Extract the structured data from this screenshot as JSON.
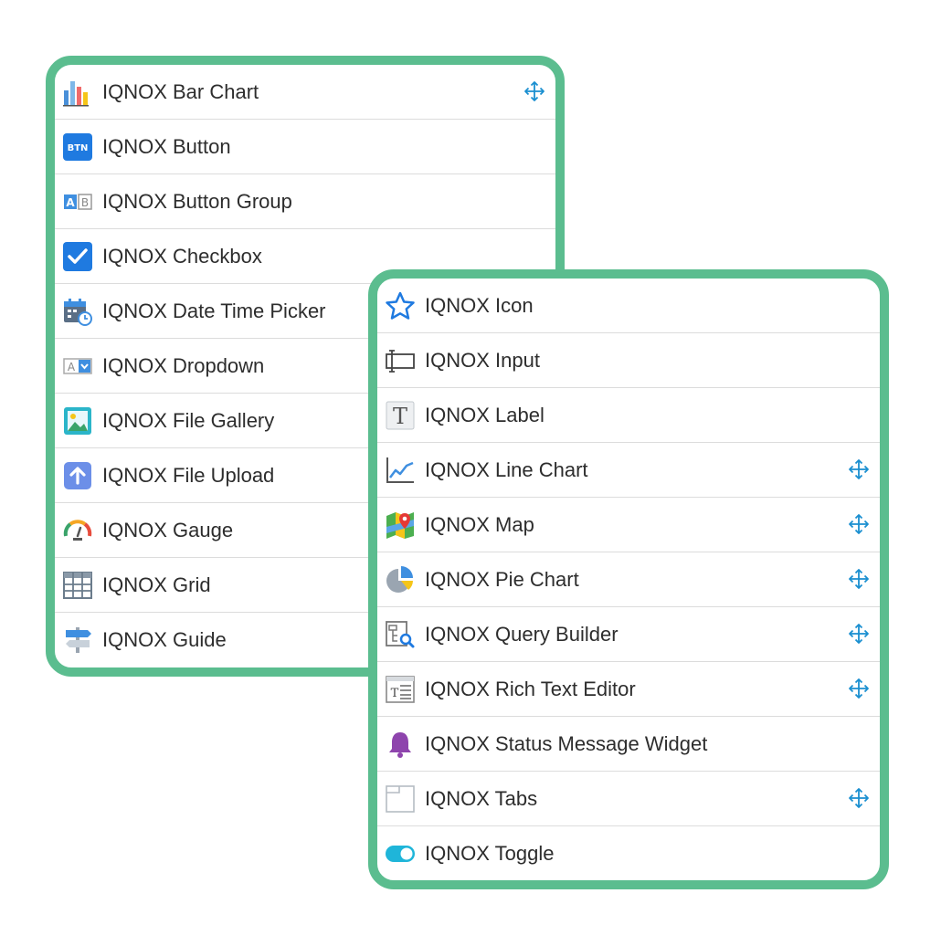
{
  "left_panel": {
    "items": [
      {
        "label": "IQNOX Bar Chart",
        "icon": "bar-chart-icon",
        "movable": true
      },
      {
        "label": "IQNOX Button",
        "icon": "button-icon",
        "movable": false
      },
      {
        "label": "IQNOX Button Group",
        "icon": "button-group-icon",
        "movable": false
      },
      {
        "label": "IQNOX Checkbox",
        "icon": "checkbox-icon",
        "movable": false
      },
      {
        "label": "IQNOX Date Time Picker",
        "icon": "calendar-clock-icon",
        "movable": false
      },
      {
        "label": "IQNOX Dropdown",
        "icon": "dropdown-icon",
        "movable": false
      },
      {
        "label": "IQNOX File Gallery",
        "icon": "gallery-icon",
        "movable": false
      },
      {
        "label": "IQNOX File Upload",
        "icon": "upload-icon",
        "movable": false
      },
      {
        "label": "IQNOX Gauge",
        "icon": "gauge-icon",
        "movable": false
      },
      {
        "label": "IQNOX Grid",
        "icon": "grid-icon",
        "movable": false
      },
      {
        "label": "IQNOX Guide",
        "icon": "signpost-icon",
        "movable": false
      }
    ]
  },
  "right_panel": {
    "items": [
      {
        "label": "IQNOX Icon",
        "icon": "star-icon",
        "movable": false
      },
      {
        "label": "IQNOX Input",
        "icon": "input-icon",
        "movable": false
      },
      {
        "label": "IQNOX Label",
        "icon": "text-label-icon",
        "movable": false
      },
      {
        "label": "IQNOX Line Chart",
        "icon": "line-chart-icon",
        "movable": true
      },
      {
        "label": "IQNOX Map",
        "icon": "map-icon",
        "movable": true
      },
      {
        "label": "IQNOX Pie Chart",
        "icon": "pie-chart-icon",
        "movable": true
      },
      {
        "label": "IQNOX Query Builder",
        "icon": "query-builder-icon",
        "movable": true
      },
      {
        "label": "IQNOX Rich Text Editor",
        "icon": "rich-text-icon",
        "movable": true
      },
      {
        "label": "IQNOX Status Message Widget",
        "icon": "bell-icon",
        "movable": false
      },
      {
        "label": "IQNOX Tabs",
        "icon": "tabs-icon",
        "movable": true
      },
      {
        "label": "IQNOX Toggle",
        "icon": "toggle-icon",
        "movable": false
      }
    ]
  },
  "colors": {
    "panel_border": "#5bbd8f",
    "move_icon": "#1a8fd0",
    "text": "#2d2d2d",
    "divider": "#dcdcdc"
  }
}
